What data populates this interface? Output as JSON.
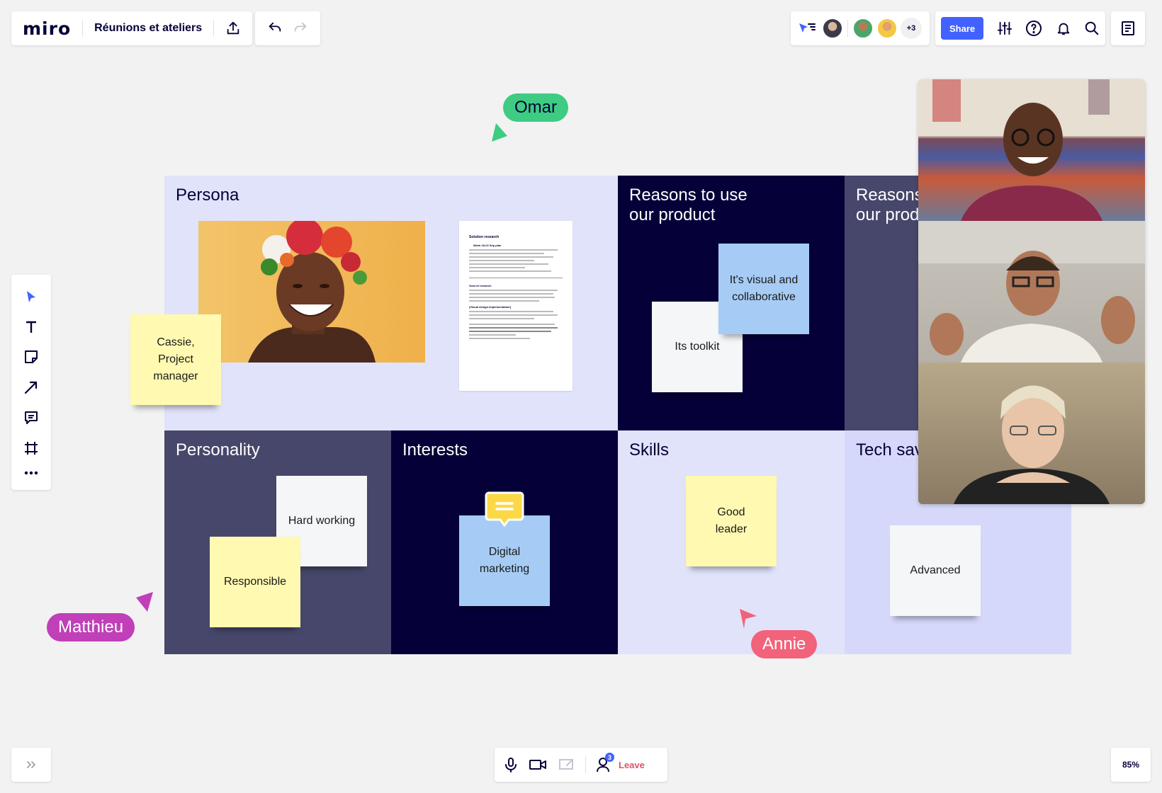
{
  "header": {
    "logo": "miro",
    "board_title": "Réunions et ateliers",
    "collaborators_more": "+3",
    "share_label": "Share"
  },
  "board": {
    "persona": {
      "title": "Persona",
      "sticky": "Cassie,\nProject\nmanager",
      "document": {
        "heading": "Solution research",
        "subheading": "Week 18-22 Sep plan",
        "goal_heading": "Goal of research",
        "design_heading": "(Visual design Implementation)"
      }
    },
    "reasons_use": {
      "title": "Reasons to use\nour product",
      "sticky_blue": "It's visual and\ncollaborative",
      "sticky_white": "Its toolkit"
    },
    "reasons_cut": {
      "title": "Reasons\nour prod"
    },
    "personality": {
      "title": "Personality",
      "sticky_white": "Hard working",
      "sticky_yellow": "Responsible"
    },
    "interests": {
      "title": "Interests",
      "sticky_blue": "Digital\nmarketing"
    },
    "skills": {
      "title": "Skills",
      "sticky_yellow": "Good\nleader"
    },
    "tech": {
      "title": "Tech sav",
      "sticky_white": "Advanced"
    }
  },
  "cursors": {
    "omar": {
      "name": "Omar",
      "color": "#3dcc82"
    },
    "matthieu": {
      "name": "Matthieu",
      "color": "#c13fb9"
    },
    "annie": {
      "name": "Annie",
      "color": "#f2627a"
    }
  },
  "call": {
    "leave_label": "Leave",
    "participants_count": "3"
  },
  "zoom": "85%",
  "colors": {
    "accent": "#4262ff",
    "board_light": "#e1e3fa",
    "board_dark": "#050038",
    "board_mid": "#47476b",
    "board_lavender": "#d6d8fb"
  }
}
